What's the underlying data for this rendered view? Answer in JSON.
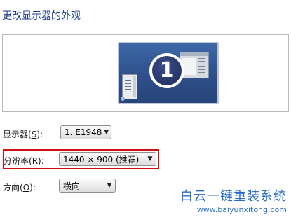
{
  "page": {
    "title": "更改显示器的外观"
  },
  "preview": {
    "monitor_number": "1"
  },
  "settings": {
    "display": {
      "label_prefix": "显示器(",
      "label_key": "S",
      "label_suffix": "):",
      "value": "1. E1948"
    },
    "resolution": {
      "label_prefix": "分辨率(",
      "label_key": "R",
      "label_suffix": "):",
      "value": "1440 × 900 (推荐)"
    },
    "orientation": {
      "label_prefix": "方向(",
      "label_key": "O",
      "label_suffix": "):",
      "value": "横向"
    }
  },
  "watermark": {
    "title": "白云一键重装系统",
    "url": "www.baiyunxitong.com"
  },
  "colors": {
    "title": "#1e3a8c",
    "highlight_border": "#d01010",
    "watermark": "#2a6fc6",
    "desktop": "#2e4f8a"
  },
  "icons": {
    "dropdown": "chevron-down-icon",
    "monitor": "monitor-icon"
  }
}
